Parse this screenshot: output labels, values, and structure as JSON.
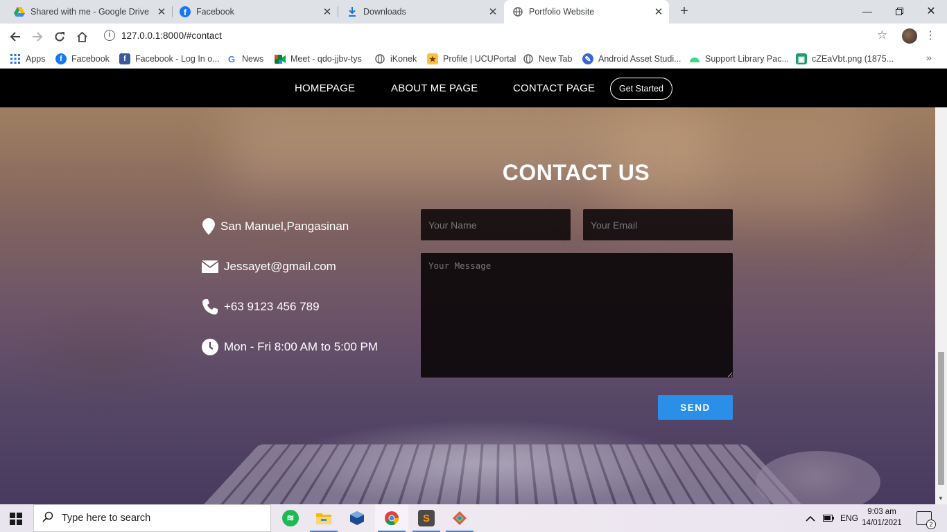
{
  "browser": {
    "tabs": [
      {
        "title": "Shared with me - Google Drive",
        "icon": "google-drive-icon"
      },
      {
        "title": "Facebook",
        "icon": "facebook-icon"
      },
      {
        "title": "Downloads",
        "icon": "download-icon"
      },
      {
        "title": "Portfolio Website",
        "icon": "globe-icon",
        "active": true
      }
    ],
    "url": "127.0.0.1:8000/#contact",
    "bookmarks": [
      {
        "label": "Apps",
        "icon": "apps-grid-icon"
      },
      {
        "label": "Facebook",
        "icon": "facebook-icon"
      },
      {
        "label": "Facebook - Log In o...",
        "icon": "facebook-icon"
      },
      {
        "label": "News",
        "icon": "google-icon"
      },
      {
        "label": "Meet - qdo-jjbv-tys",
        "icon": "google-meet-icon"
      },
      {
        "label": "iKonek",
        "icon": "globe-icon"
      },
      {
        "label": "Profile | UCUPortal",
        "icon": "portal-icon"
      },
      {
        "label": "New Tab",
        "icon": "globe-icon"
      },
      {
        "label": "Android Asset Studi...",
        "icon": "android-asset-studio-icon"
      },
      {
        "label": "Support Library Pac...",
        "icon": "android-icon"
      },
      {
        "label": "cZEaVbt.png (1875...",
        "icon": "image-icon"
      }
    ]
  },
  "site": {
    "nav": {
      "links": [
        "HOMEPAGE",
        "ABOUT ME PAGE",
        "CONTACT PAGE"
      ],
      "cta": "Get Started"
    },
    "contact": {
      "heading": "CONTACT US",
      "info": [
        {
          "icon": "map-pin-icon",
          "text": "San Manuel,Pangasinan"
        },
        {
          "icon": "envelope-icon",
          "text": "Jessayet@gmail.com"
        },
        {
          "icon": "phone-icon",
          "text": "+63 9123 456 789"
        },
        {
          "icon": "clock-icon",
          "text": "Mon - Fri 8:00 AM to 5:00 PM"
        }
      ],
      "form": {
        "name_placeholder": "Your Name",
        "email_placeholder": "Your Email",
        "message_placeholder": "Your Message",
        "send_label": "SEND"
      }
    }
  },
  "taskbar": {
    "search_placeholder": "Type here to search",
    "apps": [
      "spotify-icon",
      "file-explorer-icon",
      "virtualbox-icon",
      "chrome-icon",
      "sublime-text-icon",
      "git-tool-icon"
    ],
    "language": "ENG",
    "time": "9:03 am",
    "date": "14/01/2021",
    "notification_count": "2"
  },
  "colors": {
    "navbar": "#000000",
    "send_button": "#2a8fe8",
    "input_bg": "#120c0e"
  }
}
